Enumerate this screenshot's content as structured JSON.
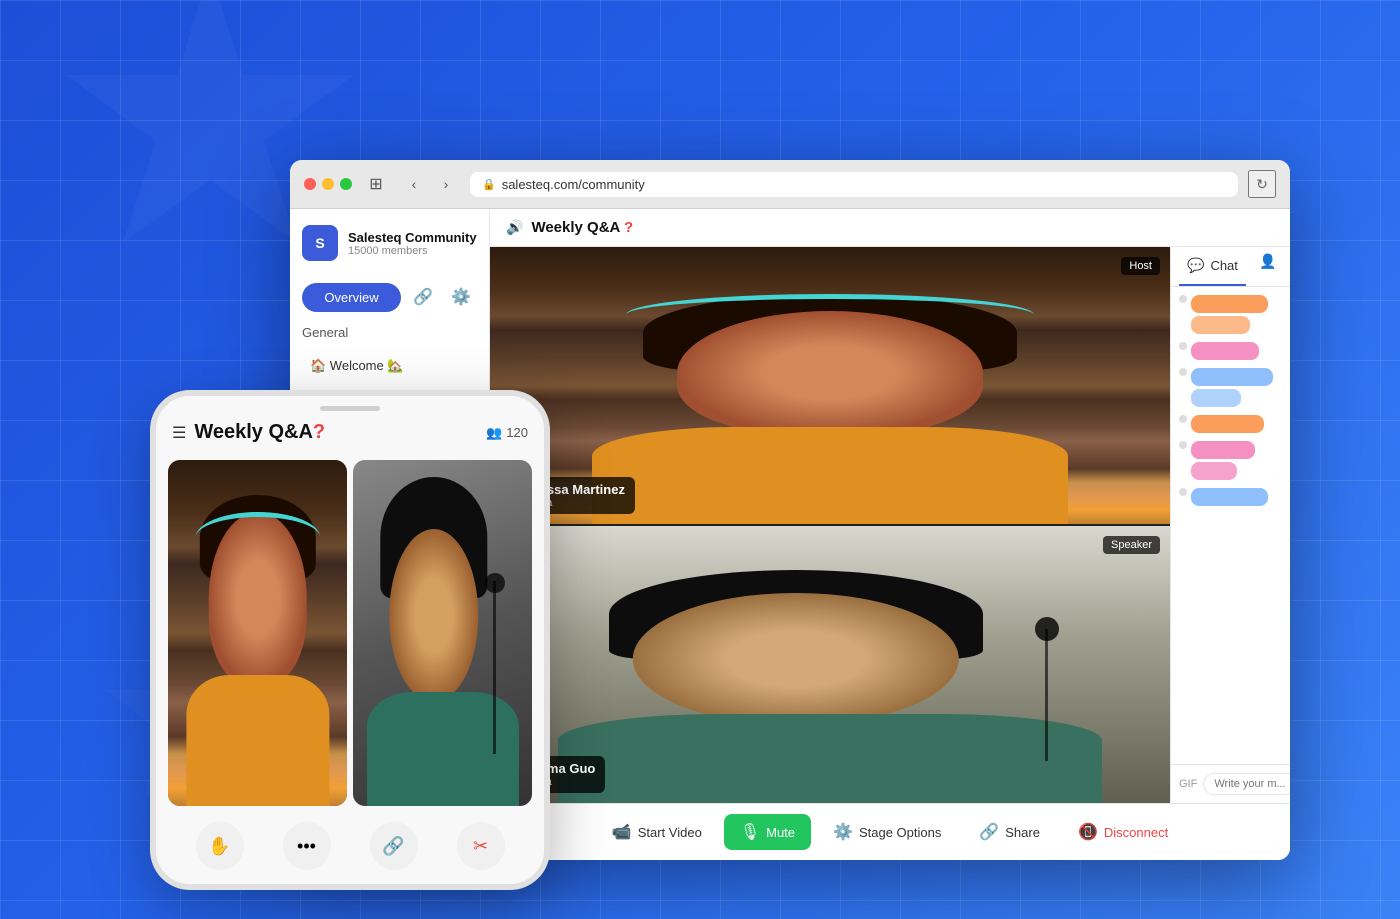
{
  "background": {
    "color": "#2563eb"
  },
  "browser": {
    "address": "salesteq.com/community",
    "buttons": {
      "back": "‹",
      "forward": "›",
      "refresh": "↻",
      "sidebar": "⊞"
    }
  },
  "sidebar": {
    "community_name": "Salesteq Community",
    "members": "15000 members",
    "logo_letter": "S",
    "overview_label": "Overview",
    "section_label": "General",
    "welcome_item": "🏠 Welcome 🏡"
  },
  "topbar": {
    "icon": "🔊",
    "title": "Weekly Q&A",
    "question_mark": "?"
  },
  "video_slots": [
    {
      "id": "slot1",
      "badge": "Host",
      "name": "Alyssa Martinez",
      "handle": "@alyssa"
    },
    {
      "id": "slot2",
      "badge": "Speaker",
      "name": "Emma Guo",
      "handle": "@emma"
    }
  ],
  "chat": {
    "tab_label": "Chat",
    "tab_icon": "💬",
    "gif_label": "GIF",
    "input_placeholder": "Write your m..."
  },
  "toolbar": {
    "start_video_label": "Start Video",
    "mute_label": "Mute",
    "stage_options_label": "Stage Options",
    "share_label": "Share",
    "disconnect_label": "Disconnect"
  },
  "phone": {
    "title": "Weekly Q&A",
    "question_mark": "?",
    "members_count": "120",
    "members_icon": "👥"
  }
}
